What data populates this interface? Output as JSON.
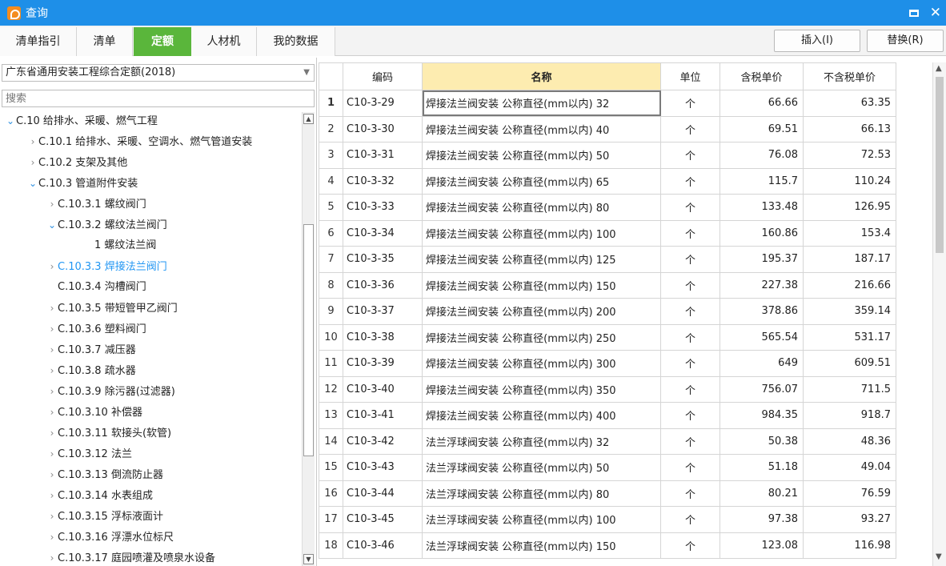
{
  "window": {
    "title": "查询"
  },
  "tabs": [
    "清单指引",
    "清单",
    "定额",
    "人材机",
    "我的数据"
  ],
  "active_tab": 2,
  "toolbar": {
    "insert_label": "插入(I)",
    "replace_label": "替换(R)"
  },
  "left": {
    "library": "广东省通用安装工程综合定额(2018)",
    "search_placeholder": "搜索",
    "tree": [
      {
        "label": "C.10 给排水、采暖、燃气工程",
        "level": 0,
        "state": "expanded"
      },
      {
        "label": "C.10.1 给排水、采暖、空调水、燃气管道安装",
        "level": 1,
        "state": "collapsed"
      },
      {
        "label": "C.10.2 支架及其他",
        "level": 1,
        "state": "collapsed"
      },
      {
        "label": "C.10.3 管道附件安装",
        "level": 1,
        "state": "expanded"
      },
      {
        "label": "C.10.3.1 螺纹阀门",
        "level": 2,
        "state": "collapsed"
      },
      {
        "label": "C.10.3.2 螺纹法兰阀门",
        "level": 2,
        "state": "expanded"
      },
      {
        "label": "1 螺纹法兰阀",
        "level": 3,
        "state": "leaf"
      },
      {
        "label": "C.10.3.3 焊接法兰阀门",
        "level": 2,
        "state": "collapsed",
        "selected": true
      },
      {
        "label": "C.10.3.4 沟槽阀门",
        "level": 2,
        "state": "leaf"
      },
      {
        "label": "C.10.3.5 带短管甲乙阀门",
        "level": 2,
        "state": "collapsed"
      },
      {
        "label": "C.10.3.6 塑料阀门",
        "level": 2,
        "state": "collapsed"
      },
      {
        "label": "C.10.3.7 减压器",
        "level": 2,
        "state": "collapsed"
      },
      {
        "label": "C.10.3.8 疏水器",
        "level": 2,
        "state": "collapsed"
      },
      {
        "label": "C.10.3.9 除污器(过滤器)",
        "level": 2,
        "state": "collapsed"
      },
      {
        "label": "C.10.3.10 补偿器",
        "level": 2,
        "state": "collapsed"
      },
      {
        "label": "C.10.3.11 软接头(软管)",
        "level": 2,
        "state": "collapsed"
      },
      {
        "label": "C.10.3.12 法兰",
        "level": 2,
        "state": "collapsed"
      },
      {
        "label": "C.10.3.13 倒流防止器",
        "level": 2,
        "state": "collapsed"
      },
      {
        "label": "C.10.3.14 水表组成",
        "level": 2,
        "state": "collapsed"
      },
      {
        "label": "C.10.3.15 浮标液面计",
        "level": 2,
        "state": "collapsed"
      },
      {
        "label": "C.10.3.16 浮漂水位标尺",
        "level": 2,
        "state": "collapsed"
      },
      {
        "label": "C.10.3.17 庭园喷灌及喷泉水设备",
        "level": 2,
        "state": "collapsed"
      }
    ]
  },
  "table": {
    "columns": [
      "",
      "编码",
      "名称",
      "单位",
      "含税单价",
      "不含税单价"
    ],
    "rows": [
      [
        "1",
        "C10-3-29",
        "焊接法兰阀安装 公称直径(mm以内) 32",
        "个",
        "66.66",
        "63.35"
      ],
      [
        "2",
        "C10-3-30",
        "焊接法兰阀安装 公称直径(mm以内) 40",
        "个",
        "69.51",
        "66.13"
      ],
      [
        "3",
        "C10-3-31",
        "焊接法兰阀安装 公称直径(mm以内) 50",
        "个",
        "76.08",
        "72.53"
      ],
      [
        "4",
        "C10-3-32",
        "焊接法兰阀安装 公称直径(mm以内) 65",
        "个",
        "115.7",
        "110.24"
      ],
      [
        "5",
        "C10-3-33",
        "焊接法兰阀安装 公称直径(mm以内) 80",
        "个",
        "133.48",
        "126.95"
      ],
      [
        "6",
        "C10-3-34",
        "焊接法兰阀安装 公称直径(mm以内) 100",
        "个",
        "160.86",
        "153.4"
      ],
      [
        "7",
        "C10-3-35",
        "焊接法兰阀安装 公称直径(mm以内) 125",
        "个",
        "195.37",
        "187.17"
      ],
      [
        "8",
        "C10-3-36",
        "焊接法兰阀安装 公称直径(mm以内) 150",
        "个",
        "227.38",
        "216.66"
      ],
      [
        "9",
        "C10-3-37",
        "焊接法兰阀安装 公称直径(mm以内) 200",
        "个",
        "378.86",
        "359.14"
      ],
      [
        "10",
        "C10-3-38",
        "焊接法兰阀安装 公称直径(mm以内) 250",
        "个",
        "565.54",
        "531.17"
      ],
      [
        "11",
        "C10-3-39",
        "焊接法兰阀安装 公称直径(mm以内) 300",
        "个",
        "649",
        "609.51"
      ],
      [
        "12",
        "C10-3-40",
        "焊接法兰阀安装 公称直径(mm以内) 350",
        "个",
        "756.07",
        "711.5"
      ],
      [
        "13",
        "C10-3-41",
        "焊接法兰阀安装 公称直径(mm以内) 400",
        "个",
        "984.35",
        "918.7"
      ],
      [
        "14",
        "C10-3-42",
        "法兰浮球阀安装 公称直径(mm以内) 32",
        "个",
        "50.38",
        "48.36"
      ],
      [
        "15",
        "C10-3-43",
        "法兰浮球阀安装 公称直径(mm以内) 50",
        "个",
        "51.18",
        "49.04"
      ],
      [
        "16",
        "C10-3-44",
        "法兰浮球阀安装 公称直径(mm以内) 80",
        "个",
        "80.21",
        "76.59"
      ],
      [
        "17",
        "C10-3-45",
        "法兰浮球阀安装 公称直径(mm以内) 100",
        "个",
        "97.38",
        "93.27"
      ],
      [
        "18",
        "C10-3-46",
        "法兰浮球阀安装 公称直径(mm以内) 150",
        "个",
        "123.08",
        "116.98"
      ]
    ],
    "current_row": 0
  },
  "colors": {
    "titlebar": "#1e8fe8",
    "active_tab": "#5ab63b",
    "name_header": "#fdecb0",
    "selected_tree": "#2196f3"
  }
}
